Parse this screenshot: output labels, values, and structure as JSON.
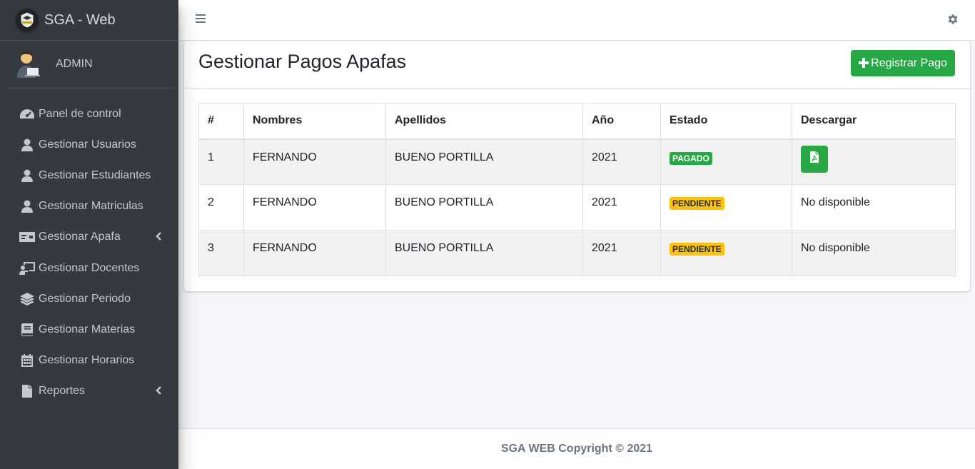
{
  "brand": {
    "title": "SGA - Web"
  },
  "user": {
    "name": "ADMIN"
  },
  "sidebar": {
    "items": [
      {
        "label": "Panel de control",
        "icon": "tachometer-icon",
        "has_arrow": false
      },
      {
        "label": "Gestionar Usuarios",
        "icon": "user-icon",
        "has_arrow": false
      },
      {
        "label": "Gestionar Estudiantes",
        "icon": "user-icon",
        "has_arrow": false
      },
      {
        "label": "Gestionar Matriculas",
        "icon": "user-icon",
        "has_arrow": false
      },
      {
        "label": "Gestionar Apafa",
        "icon": "money-bill-icon",
        "has_arrow": true
      },
      {
        "label": "Gestionar Docentes",
        "icon": "chalkboard-teacher-icon",
        "has_arrow": false
      },
      {
        "label": "Gestionar Periodo",
        "icon": "layer-group-icon",
        "has_arrow": false
      },
      {
        "label": "Gestionar Materias",
        "icon": "book-icon",
        "has_arrow": false
      },
      {
        "label": "Gestionar Horarios",
        "icon": "calendar-icon",
        "has_arrow": false
      },
      {
        "label": "Reportes",
        "icon": "file-icon",
        "has_arrow": true
      }
    ]
  },
  "main": {
    "title": "Gestionar Pagos Apafas",
    "register_button": "Registrar Pago",
    "table": {
      "headers": [
        "#",
        "Nombres",
        "Apellidos",
        "Año",
        "Estado",
        "Descargar"
      ],
      "rows": [
        {
          "num": "1",
          "nombres": "FERNANDO",
          "apellidos": "BUENO PORTILLA",
          "anio": "2021",
          "estado": "PAGADO",
          "estado_type": "success",
          "descargar": ""
        },
        {
          "num": "2",
          "nombres": "FERNANDO",
          "apellidos": "BUENO PORTILLA",
          "anio": "2021",
          "estado": "PENDIENTE",
          "estado_type": "warning",
          "descargar": "No disponible"
        },
        {
          "num": "3",
          "nombres": "FERNANDO",
          "apellidos": "BUENO PORTILLA",
          "anio": "2021",
          "estado": "PENDIENTE",
          "estado_type": "warning",
          "descargar": "No disponible"
        }
      ]
    }
  },
  "footer": {
    "text": "SGA WEB Copyright © 2021"
  },
  "colors": {
    "sidebar": "#343a40",
    "success": "#28a745",
    "warning": "#ffc107"
  }
}
